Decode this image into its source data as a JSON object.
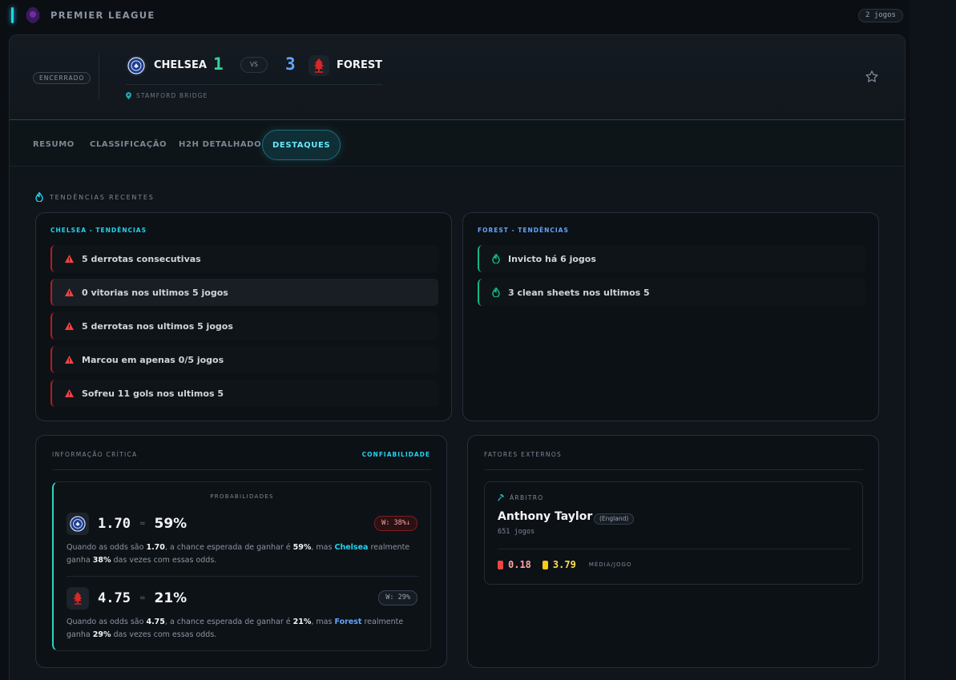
{
  "league": {
    "name": "PREMIER LEAGUE",
    "count": "2 jogos"
  },
  "match": {
    "status": "ENCERRADO",
    "home": {
      "name": "CHELSEA",
      "score": "1"
    },
    "away": {
      "name": "FOREST",
      "score": "3"
    },
    "vs": "VS",
    "venue": "STAMFORD BRIDGE"
  },
  "tabs": [
    {
      "label": "RESUMO"
    },
    {
      "label": "CLASSIFICAÇÃO"
    },
    {
      "label": "H2H DETALHADO"
    },
    {
      "label": "DESTAQUES"
    }
  ],
  "trends": {
    "section_title": "TENDÊNCIAS RECENTES",
    "home": {
      "title": "CHELSEA - TENDÊNCIAS",
      "items": [
        "5 derrotas consecutivas",
        "0 vitorias nos ultimos 5 jogos",
        "5 derrotas nos ultimos 5 jogos",
        "Marcou em apenas 0/5 jogos",
        "Sofreu 11 gols nos ultimos 5"
      ]
    },
    "away": {
      "title": "FOREST - TENDÊNCIAS",
      "items": [
        "Invicto há 6 jogos",
        "3 clean sheets nos ultimos 5"
      ]
    }
  },
  "critical": {
    "title": "INFORMAÇÃO CRÍTICA",
    "reliability": "CONFIABILIDADE",
    "prob_title": "PROBABILIDADES",
    "home": {
      "odds": "1.70",
      "eq": "=",
      "pct": "59%",
      "badge": "W: 38%↓",
      "text": {
        "p1": "Quando as odds são ",
        "odds": "1.70",
        "p2": ", a chance esperada de ganhar é ",
        "pct": "59%",
        "p3": ", mas ",
        "team": "Chelsea",
        "p4": " realmente ganha ",
        "win": "38%",
        "p5": " das vezes com essas odds."
      }
    },
    "away": {
      "odds": "4.75",
      "eq": "=",
      "pct": "21%",
      "badge": "W: 29%",
      "text": {
        "p1": "Quando as odds são ",
        "odds": "4.75",
        "p2": ", a chance esperada de ganhar é ",
        "pct": "21%",
        "p3": ", mas ",
        "team": "Forest",
        "p4": " realmente ganha ",
        "win": "29%",
        "p5": " das vezes com essas odds."
      }
    }
  },
  "external": {
    "title": "FATORES EXTERNOS",
    "referee_label": "ÁRBITRO",
    "referee_name": "Anthony Taylor",
    "referee_country": "(England)",
    "referee_games": "651 jogos",
    "red_avg": "0.18",
    "yellow_avg": "3.79",
    "avg_label": "MÉDIA/JOGO"
  },
  "colors": {
    "accent": "#22d3ee",
    "home": "#34d399",
    "away": "#60a5fa",
    "danger": "#ef4444",
    "success": "#10b981"
  }
}
